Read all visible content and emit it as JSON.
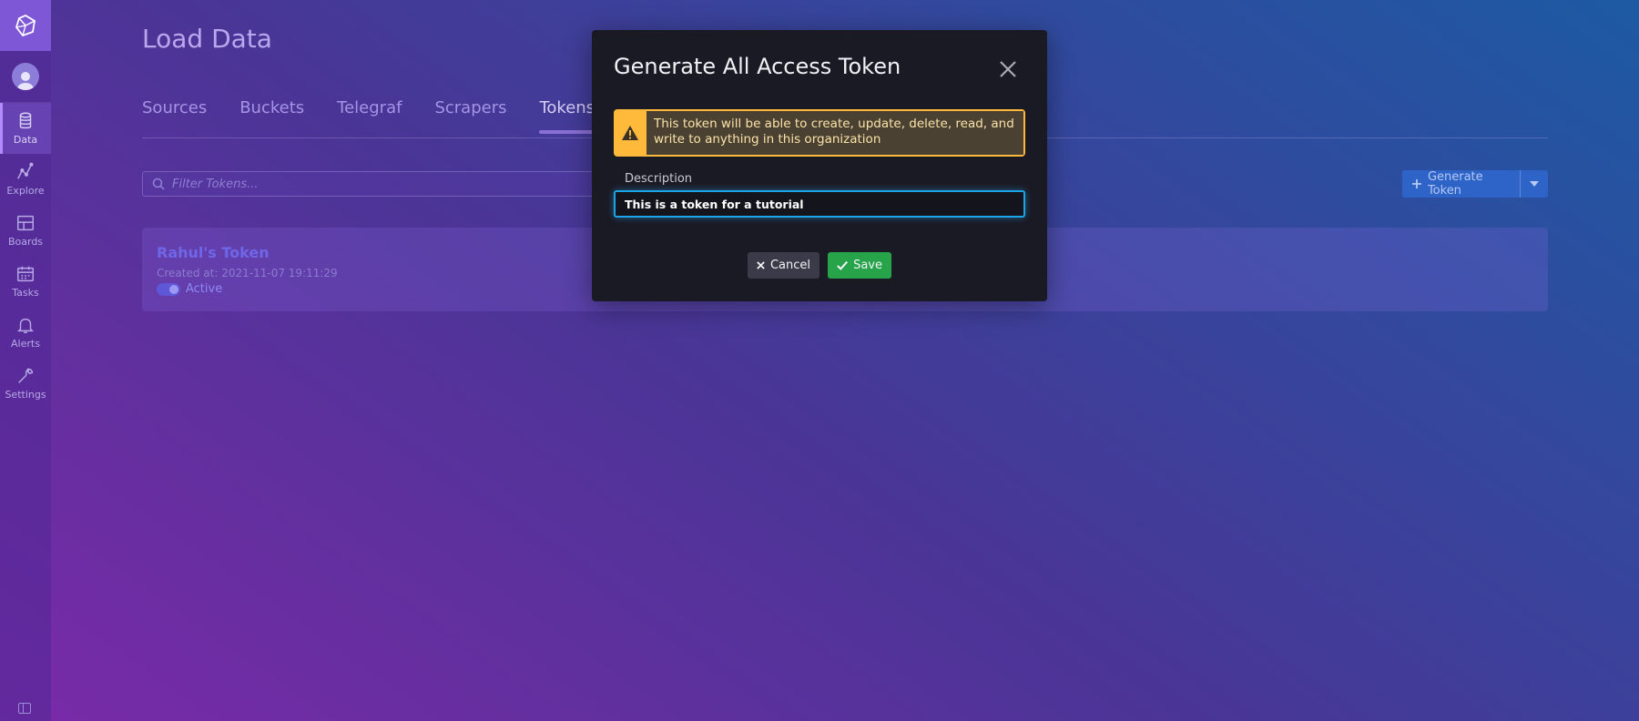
{
  "sidebar": {
    "nav": [
      {
        "label": "Data",
        "icon": "database-icon",
        "active": true
      },
      {
        "label": "Explore",
        "icon": "graph-icon",
        "active": false
      },
      {
        "label": "Boards",
        "icon": "dashboard-icon",
        "active": false
      },
      {
        "label": "Tasks",
        "icon": "calendar-icon",
        "active": false
      },
      {
        "label": "Alerts",
        "icon": "bell-icon",
        "active": false
      },
      {
        "label": "Settings",
        "icon": "wrench-icon",
        "active": false
      }
    ]
  },
  "page": {
    "title": "Load Data",
    "tabs": [
      "Sources",
      "Buckets",
      "Telegraf",
      "Scrapers",
      "Tokens"
    ],
    "active_tab": "Tokens",
    "filter_placeholder": "Filter Tokens...",
    "generate_button": "Generate Token"
  },
  "token": {
    "name": "Rahul's Token",
    "created": "Created at: 2021-11-07 19:11:29",
    "status": "Active"
  },
  "modal": {
    "title": "Generate All Access Token",
    "warning": "This token will be able to create, update, delete, read, and write to anything in this organization",
    "description_label": "Description",
    "description_value": "This is a token for a tutorial",
    "cancel_label": "Cancel",
    "save_label": "Save"
  },
  "colors": {
    "accent": "#1fa3e8",
    "warning": "#ffb93b",
    "save": "#27a34a",
    "primary": "#2e63c8"
  }
}
